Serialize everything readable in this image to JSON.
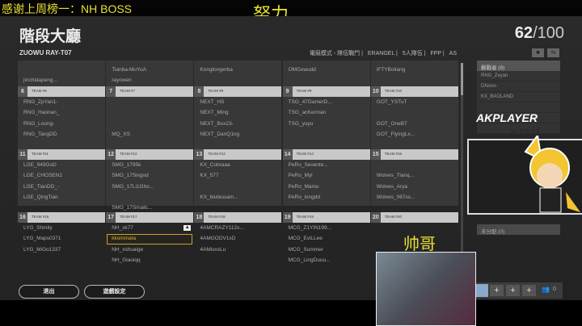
{
  "overlay": {
    "thanks": "感谢上周榜一：NH BOSS",
    "effort": "努力",
    "handsome": "帅哥",
    "logo": "AKPLAYER",
    "logo_sub": "NIVOSE"
  },
  "header": {
    "title": "階段大廳",
    "count": "62",
    "max": "/100",
    "room": "ZUOWU RAY-T07",
    "modes": [
      "電競模式 - 隊伍戰鬥",
      "ERANGEL",
      "5人隊伍",
      "FPP",
      "AS"
    ]
  },
  "top_rows": [
    [
      "",
      "Tianba-MuYuA",
      "Konglongerba",
      "OMGxwudd",
      "iFTYBoliang"
    ],
    [
      "jinchidapeng...",
      "rayowen",
      "",
      "",
      ""
    ]
  ],
  "teams": [
    {
      "num": "6",
      "name": "TEAM #6",
      "players": [
        "RNG_ZpYan1-",
        "RNG_Haonan_",
        "RNG_Loong-",
        "RNG_TangDD",
        ""
      ]
    },
    {
      "num": "7",
      "name": "TEAM #7",
      "players": [
        "",
        "",
        "",
        "MQ_XS",
        ""
      ]
    },
    {
      "num": "8",
      "name": "TEAM #8",
      "players": [
        "NEXT_HS",
        "NEXT_Ming",
        "NEXT_Box23-",
        "NEXT_DanQ1ng",
        ""
      ]
    },
    {
      "num": "9",
      "name": "TEAM #9",
      "players": [
        "TSG_47GamerD...",
        "TSG_acKerman",
        "TSG_yuyu",
        "",
        ""
      ]
    },
    {
      "num": "10",
      "name": "TEAM #10",
      "players": [
        "GOT_YSTuT",
        "",
        "GOT_OneB7",
        "GOT_FlyingLx...",
        ""
      ]
    },
    {
      "num": "11",
      "name": "TEAM #11",
      "players": [
        "LGE_949GoD",
        "LGE_CHOSEN1",
        "LGE_TianDD_-",
        "LGE_QingTian",
        ""
      ]
    },
    {
      "num": "12",
      "name": "TEAM #12",
      "players": [
        "SMG_1795k",
        "SMG_17Sixgod",
        "SMG_17Li1Gho...",
        "",
        "SMG_17Smallc..."
      ]
    },
    {
      "num": "13",
      "name": "TEAM #13",
      "players": [
        "KX_Cobraaa",
        "KX_577",
        "",
        "KX_biubiusam...",
        ""
      ]
    },
    {
      "num": "14",
      "name": "TEAM #14",
      "players": [
        "PeRo_Sevente...",
        "PeRo_Myl",
        "PeRo_Mamu",
        "PeRo_longdd",
        ""
      ]
    },
    {
      "num": "15",
      "name": "TEAM #15",
      "players": [
        "",
        "Wolves_Tianq...",
        "Wolves_Arya",
        "Wolves_067xx...",
        ""
      ]
    },
    {
      "num": "16",
      "name": "TEAM #16",
      "players": [
        "LYG_Shmily",
        "LYG_Maps0371",
        "LYG_MiGo1337",
        "",
        ""
      ]
    },
    {
      "num": "17",
      "name": "TEAM #17",
      "players": [
        "NH_xk77",
        "kkommata",
        "NH_xshuaige",
        "NH_Giaoiqq",
        ""
      ]
    },
    {
      "num": "18",
      "name": "TEAM #18",
      "players": [
        "4AMCRAZY112x...",
        "4AMGODV1xD",
        "4AMixxxLu",
        "",
        ""
      ]
    },
    {
      "num": "19",
      "name": "TEAM #19",
      "players": [
        "MCG_Z1YIN199...",
        "MCG_EviLLee",
        "MCG_Summer",
        "MCG_LingDuuu...",
        ""
      ]
    },
    {
      "num": "20",
      "name": "TEAM #20",
      "players": [
        "",
        "",
        "",
        "",
        ""
      ]
    }
  ],
  "spectators": {
    "title": "觀戰者 (9)",
    "items": [
      "RNG_Zeyan",
      "DNovo-",
      "KX_BAOLAND"
    ]
  },
  "unassigned": "未分配 (0)",
  "bottom": {
    "count": "0",
    "plus": "+"
  },
  "buttons": {
    "exit": "退出",
    "settings": "遊戲設定"
  }
}
